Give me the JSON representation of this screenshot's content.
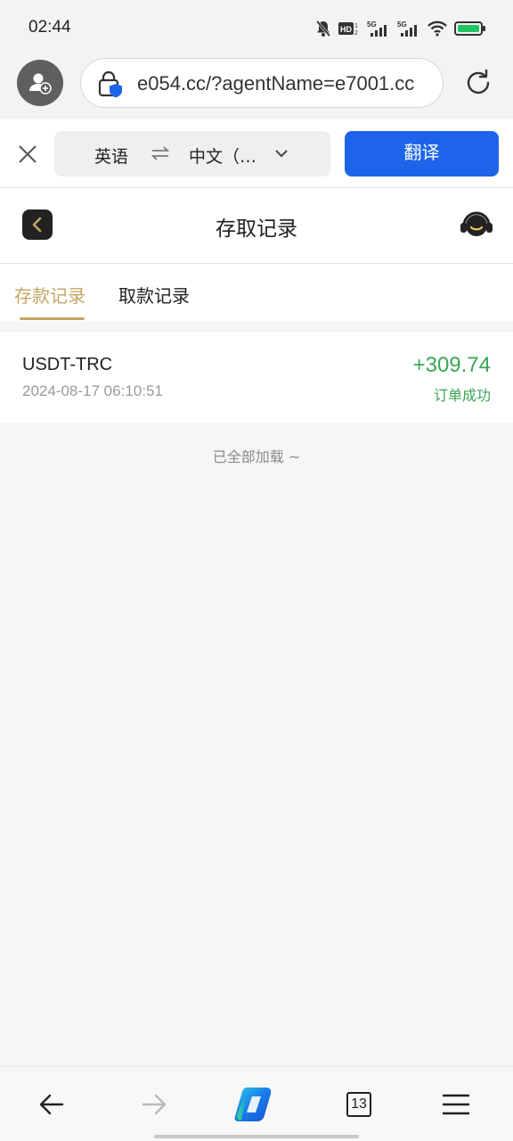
{
  "status_bar": {
    "time": "02:44",
    "icons": [
      "bell-muted-icon",
      "hd-icon",
      "signal-5g-icon",
      "signal-5g-icon",
      "wifi-icon",
      "battery-icon"
    ],
    "battery_color": "#22c55e"
  },
  "browser": {
    "url": "e054.cc/?agentName=e7001.cc",
    "icons": [
      "profile-add-icon",
      "lock-shield-icon",
      "reload-icon"
    ]
  },
  "translate_bar": {
    "source_lang": "英语",
    "target_lang": "中文（…",
    "translate_label": "翻译",
    "accent": "#1e64ea"
  },
  "header": {
    "title": "存取记录",
    "icons": [
      "back-chevron-icon",
      "headset-icon"
    ]
  },
  "tabs": [
    {
      "label": "存款记录",
      "active": true
    },
    {
      "label": "取款记录",
      "active": false
    }
  ],
  "accent_gold": "#c3a565",
  "records": [
    {
      "currency": "USDT-TRC",
      "time": "2024-08-17 06:10:51",
      "amount": "+309.74",
      "status": "订单成功",
      "status_color": "#3aa655"
    }
  ],
  "footer_text": "已全部加载 ~",
  "bottom_nav": {
    "tabs_count": "13",
    "icons": [
      "back-arrow-icon",
      "forward-arrow-icon",
      "copilot-icon",
      "tabs-icon",
      "menu-icon"
    ]
  }
}
